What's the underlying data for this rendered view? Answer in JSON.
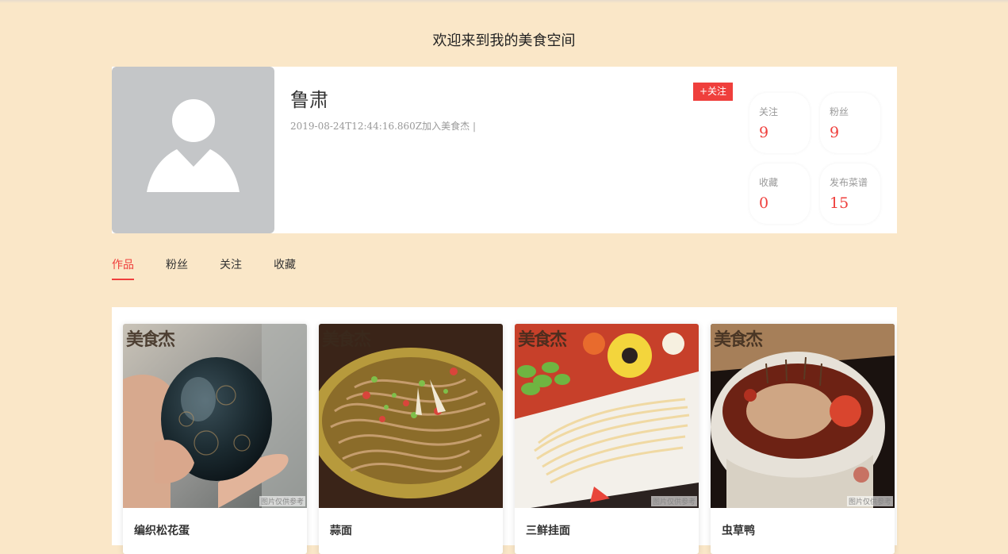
{
  "page": {
    "title": "欢迎来到我的美食空间"
  },
  "profile": {
    "name": "鲁肃",
    "join_info": "2019-08-24T12:44:16.860Z加入美食杰 |",
    "follow_label": "+关注",
    "avatar_icon": "user-silhouette-icon",
    "stats": [
      {
        "label": "关注",
        "value": "9"
      },
      {
        "label": "粉丝",
        "value": "9"
      },
      {
        "label": "收藏",
        "value": "0"
      },
      {
        "label": "发布菜谱",
        "value": "15"
      }
    ]
  },
  "tabs": [
    {
      "label": "作品",
      "active": true
    },
    {
      "label": "粉丝",
      "active": false
    },
    {
      "label": "关注",
      "active": false
    },
    {
      "label": "收藏",
      "active": false
    }
  ],
  "works": [
    {
      "title": "编织松花蛋",
      "image": "preserved-egg-photo",
      "watermark_logo": "美食杰",
      "watermark_note": "图片仅供参考"
    },
    {
      "title": "蒜面",
      "image": "garlic-noodles-photo",
      "watermark_logo": "美食杰",
      "watermark_note": ""
    },
    {
      "title": "三鲜挂面",
      "image": "noodles-platter-photo",
      "watermark_logo": "美食杰",
      "watermark_note": "图片仅供参考"
    },
    {
      "title": "虫草鸭",
      "image": "cordyceps-duck-photo",
      "watermark_logo": "美食杰",
      "watermark_note": "图片仅供参考"
    }
  ],
  "colors": {
    "background": "#fae7c8",
    "accent": "#ef3f3c",
    "card": "#ffffff",
    "avatar_bg": "#c4c6c8"
  }
}
